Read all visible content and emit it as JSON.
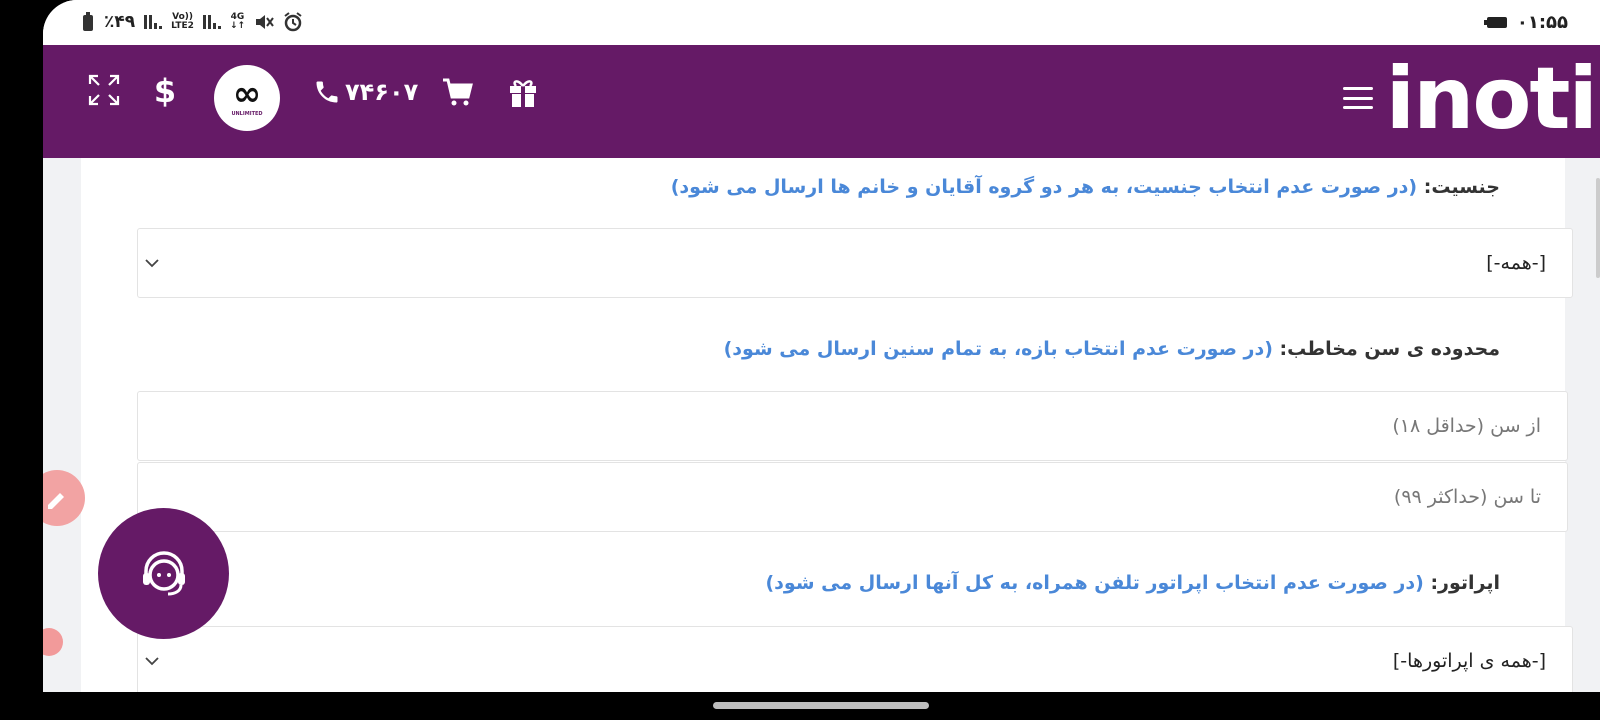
{
  "status_bar": {
    "battery_percent": "٪۴۹",
    "volte_label_top": "Vo))",
    "volte_label_bottom": "LTE2",
    "network_label_top": "4G",
    "network_label_bottom": "↓↑",
    "time": "۰۱:۵۵"
  },
  "header": {
    "logo_symbol": "∞",
    "logo_text": "UNLIMITED",
    "phone_number": "۷۴۶۰۷",
    "brand": "inoti",
    "currency_symbol": "$",
    "colors": {
      "header_bg": "#651a66",
      "hint_blue": "#4a88d8"
    }
  },
  "form": {
    "gender": {
      "label": "جنسیت:",
      "hint": "(در صورت عدم انتخاب جنسیت، به هر دو گروه آقایان و خانم ها ارسال می شود)",
      "selected": "[-همه-]"
    },
    "age": {
      "label": "محدوده ی سن مخاطب:",
      "hint": "(در صورت عدم انتخاب بازه، به تمام سنین ارسال می شود)",
      "from_placeholder": "از سن (حداقل ۱۸)",
      "to_placeholder": "تا سن (حداکثر ۹۹)"
    },
    "operator": {
      "label": "اپراتور:",
      "hint": "(در صورت عدم انتخاب اپراتور تلفن همراه، به کل آنها ارسال می شود)",
      "selected": "[-همه ی اپراتورها-]"
    }
  }
}
